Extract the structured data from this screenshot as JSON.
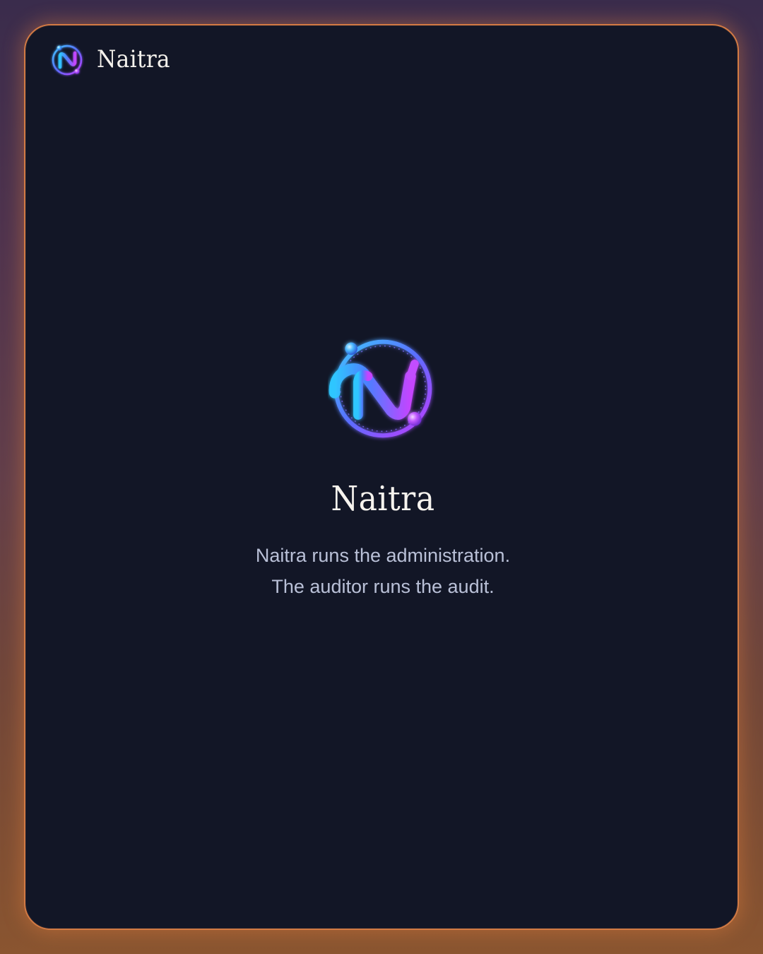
{
  "header": {
    "brand_name": "Naitra",
    "logo_icon": "naitra-orbit-logo-icon"
  },
  "hero": {
    "logo_icon": "naitra-orbit-logo-icon",
    "title": "Naitra",
    "tagline_line_1": "Naitra runs the administration.",
    "tagline_line_2": "The auditor runs the audit."
  },
  "colors": {
    "card_background": "#121626",
    "card_border": "#d27a44",
    "text_primary": "#f4f1ec",
    "text_secondary": "#b9c0d7",
    "logo_blue": "#35b8ff",
    "logo_purple": "#a93cff"
  }
}
